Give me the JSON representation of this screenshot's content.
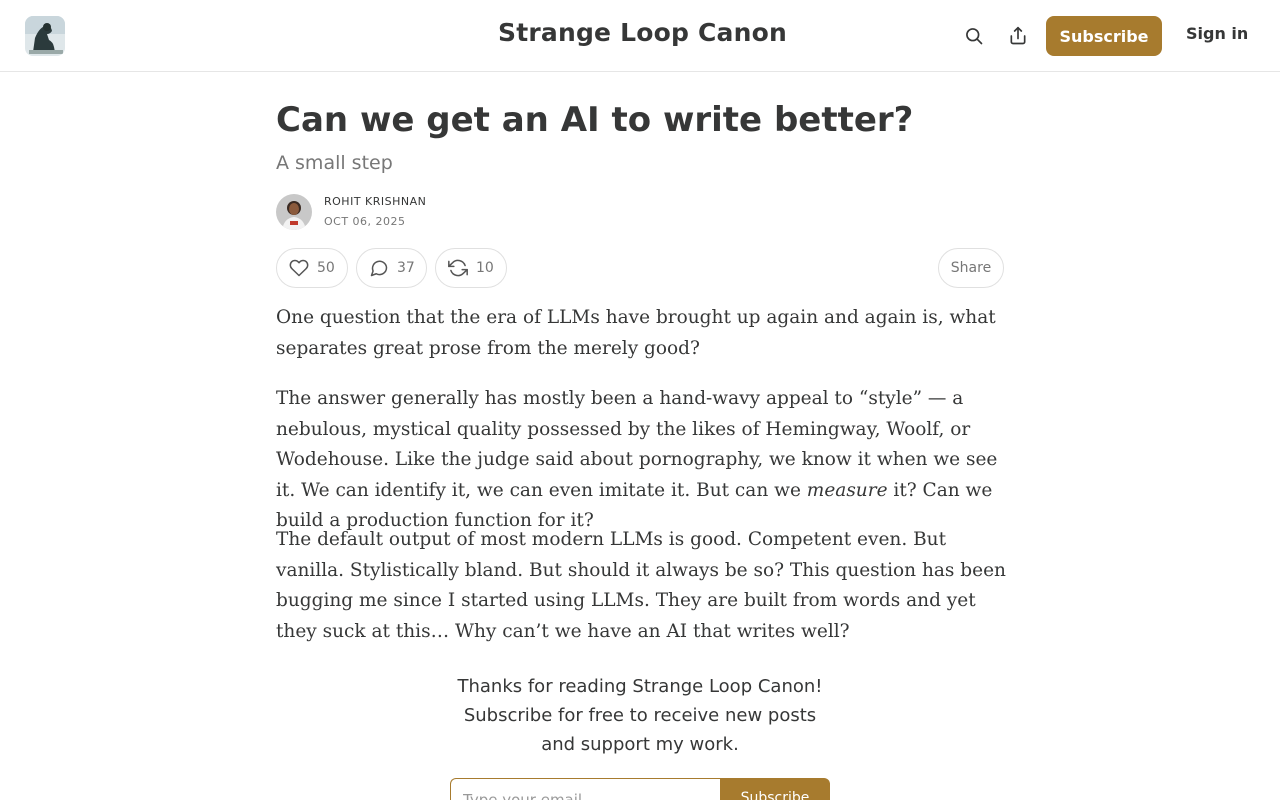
{
  "header": {
    "publication_name": "Strange Loop Canon",
    "subscribe_label": "Subscribe",
    "signin_label": "Sign in",
    "icons": {
      "search": "search-icon",
      "share": "share-icon"
    },
    "accent_color": "#a77b2e"
  },
  "post": {
    "title": "Can we get an AI to write better?",
    "subtitle": "A small step",
    "author": "ROHIT KRISHNAN",
    "date": "OCT 06, 2025",
    "likes": "50",
    "comments": "37",
    "restacks": "10",
    "share_label": "Share",
    "paragraphs": {
      "p1": "One question that the era of LLMs have brought up again and again is, what separates great prose from the merely good?",
      "p2_before": "The answer generally has mostly been a hand-wavy appeal to “style” — a nebulous, mystical quality possessed by the likes of Hemingway, Woolf, or Wodehouse. Like the judge said about pornography, we know it when we see it. We can identify it, we can even imitate it. But can we ",
      "p2_em": "measure",
      "p2_after": " it? Can we build a production function for it?",
      "p3": "The default output of most modern LLMs is good. Competent even. But vanilla. Stylistically bland. But should it always be so? This question has been bugging me since I started using LLMs. They are built from words and yet they suck at this… Why can’t we have an AI that writes well?"
    }
  },
  "cta": {
    "line1": "Thanks for reading Strange Loop Canon!",
    "line2": "Subscribe for free to receive new posts",
    "line3": "and support my work.",
    "email_placeholder": "Type your email…",
    "button_label": "Subscribe"
  }
}
